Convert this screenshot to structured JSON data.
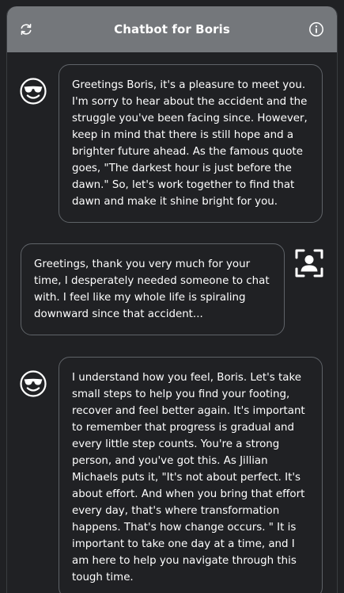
{
  "header": {
    "title": "Chatbot for Boris",
    "refresh_icon": "refresh-icon",
    "info_icon": "info-icon"
  },
  "colors": {
    "header_bg": "#74777b",
    "page_bg": "#202124",
    "bubble_border": "#5f6368",
    "text": "#ffffff"
  },
  "messages": [
    {
      "sender": "bot",
      "avatar_icon": "sunglasses-smiley-icon",
      "text": "Greetings Boris, it's a pleasure to meet you. I'm sorry to hear about the accident and the struggle you've been facing since. However, keep in mind that there is still hope and a brighter future ahead. As the famous quote goes, \"The darkest hour is just before the dawn.\" So, let's work together to find that dawn and make it shine bright for you."
    },
    {
      "sender": "user",
      "avatar_icon": "user-scan-icon",
      "text": "Greetings, thank you very much for your time, I desperately needed someone to chat with. I feel like my whole life is spiraling downward since that accident..."
    },
    {
      "sender": "bot",
      "avatar_icon": "sunglasses-smiley-icon",
      "text": "I understand how you feel, Boris. Let's take small steps to help you find your footing, recover and feel better again. It's important to remember that progress is gradual and every little step counts. You're a strong person, and you've got this. As Jillian Michaels puts it, \"It's not about perfect. It's about effort. And when you bring that effort every day, that's where transformation happens. That's how change occurs. \" It is important to take one day at a time, and I am here to help you navigate through this tough time."
    }
  ]
}
